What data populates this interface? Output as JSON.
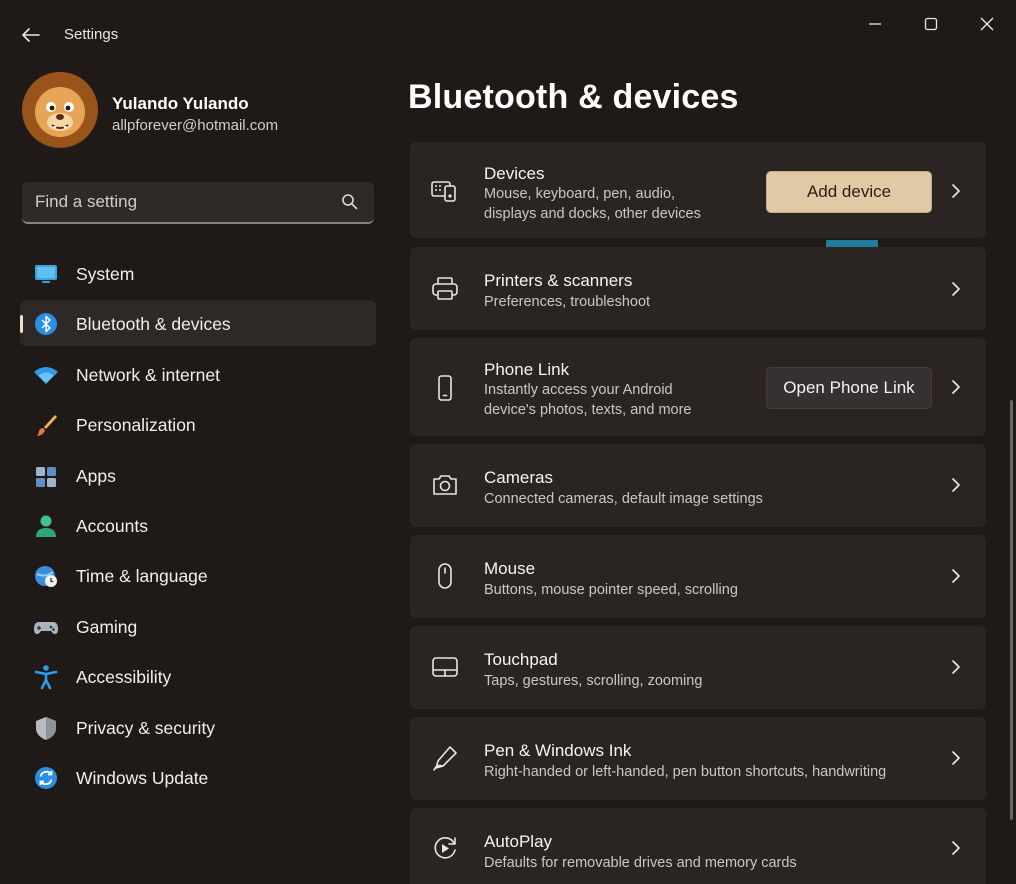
{
  "window": {
    "title": "Settings",
    "controls": {
      "minimize": "minimize",
      "maximize": "maximize",
      "close": "close"
    }
  },
  "profile": {
    "name": "Yulando Yulando",
    "email": "allpforever@hotmail.com"
  },
  "search": {
    "placeholder": "Find a setting"
  },
  "sidebar": {
    "items": [
      {
        "label": "System",
        "icon": "system-icon",
        "active": false
      },
      {
        "label": "Bluetooth & devices",
        "icon": "bluetooth-icon",
        "active": true
      },
      {
        "label": "Network & internet",
        "icon": "wifi-icon",
        "active": false
      },
      {
        "label": "Personalization",
        "icon": "brush-icon",
        "active": false
      },
      {
        "label": "Apps",
        "icon": "apps-icon",
        "active": false
      },
      {
        "label": "Accounts",
        "icon": "person-icon",
        "active": false
      },
      {
        "label": "Time & language",
        "icon": "globe-clock-icon",
        "active": false
      },
      {
        "label": "Gaming",
        "icon": "gamepad-icon",
        "active": false
      },
      {
        "label": "Accessibility",
        "icon": "accessibility-icon",
        "active": false
      },
      {
        "label": "Privacy & security",
        "icon": "shield-icon",
        "active": false
      },
      {
        "label": "Windows Update",
        "icon": "update-icon",
        "active": false
      }
    ]
  },
  "main": {
    "title": "Bluetooth & devices",
    "cards": [
      {
        "title": "Devices",
        "desc1": "Mouse, keyboard, pen, audio,",
        "desc2": "displays and docks, other devices",
        "button": "Add device",
        "icon": "devices-icon"
      },
      {
        "title": "Printers & scanners",
        "desc1": "Preferences, troubleshoot",
        "icon": "printer-icon"
      },
      {
        "title": "Phone Link",
        "desc1": "Instantly access your Android",
        "desc2": "device's photos, texts, and more",
        "button": "Open Phone Link",
        "icon": "phone-icon"
      },
      {
        "title": "Cameras",
        "desc1": "Connected cameras, default image settings",
        "icon": "camera-icon"
      },
      {
        "title": "Mouse",
        "desc1": "Buttons, mouse pointer speed, scrolling",
        "icon": "mouse-icon"
      },
      {
        "title": "Touchpad",
        "desc1": "Taps, gestures, scrolling, zooming",
        "icon": "touchpad-icon"
      },
      {
        "title": "Pen & Windows Ink",
        "desc1": "Right-handed or left-handed, pen button shortcuts, handwriting",
        "icon": "pen-icon"
      },
      {
        "title": "AutoPlay",
        "desc1": "Defaults for removable drives and memory cards",
        "icon": "autoplay-icon"
      }
    ]
  },
  "colors": {
    "background": "#1f1a18",
    "card": "#2a2523",
    "accent_button": "#e2c9a6",
    "accent_blue": "#1f7c9a"
  }
}
